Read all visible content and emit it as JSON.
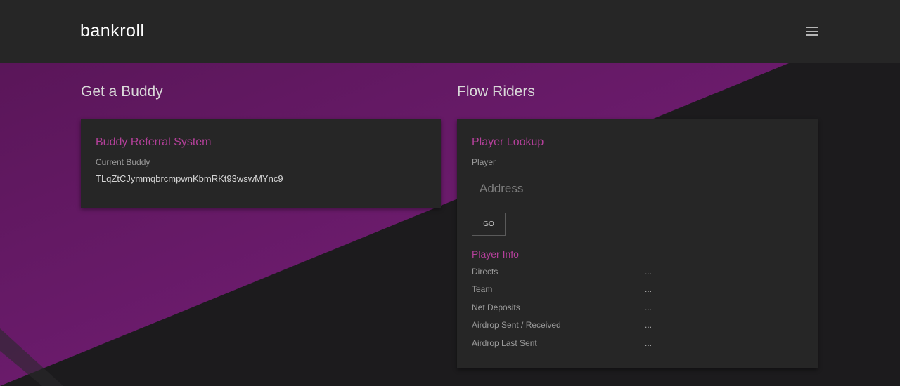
{
  "header": {
    "logo": "bankroll",
    "menu_icon": "hamburger-menu-icon"
  },
  "left": {
    "section_title": "Get a Buddy",
    "card_title": "Buddy Referral System",
    "current_buddy_label": "Current Buddy",
    "current_buddy_value": "TLqZtCJymmqbrcmpwnKbmRKt93wswMYnc9"
  },
  "right": {
    "section_title": "Flow Riders",
    "card_title": "Player Lookup",
    "player_label": "Player",
    "address_placeholder": "Address",
    "address_value": "",
    "go_label": "GO",
    "info_title": "Player Info",
    "info_rows": [
      {
        "label": "Directs",
        "value": "..."
      },
      {
        "label": "Team",
        "value": "..."
      },
      {
        "label": "Net Deposits",
        "value": "..."
      },
      {
        "label": "Airdrop Sent / Received",
        "value": "..."
      },
      {
        "label": "Airdrop Last Sent",
        "value": "..."
      }
    ]
  },
  "colors": {
    "accent": "#b5409b",
    "background_purple": "#6d1a6e",
    "navbar": "#262626",
    "card": "#262626"
  }
}
